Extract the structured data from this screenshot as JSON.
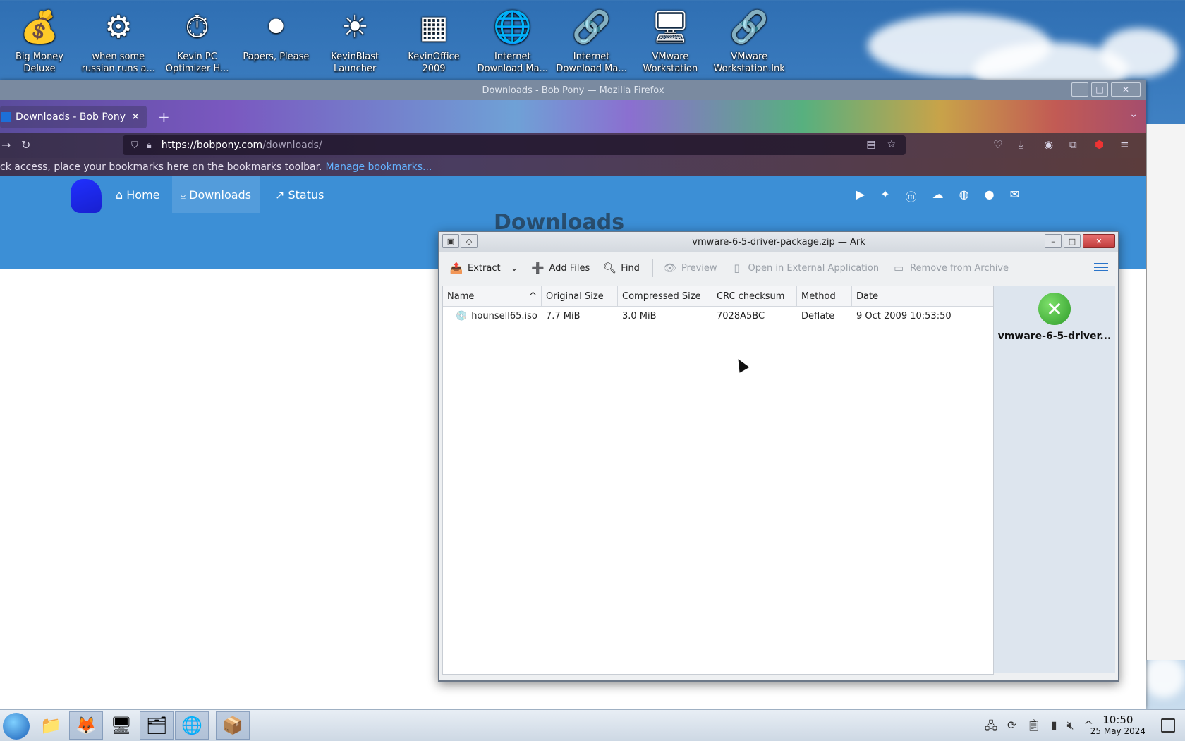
{
  "desktop": {
    "icons": [
      {
        "label": "Big Money\nDeluxe",
        "glyph": "💰",
        "icon": "money-bag-icon"
      },
      {
        "label": "when some\nrussian runs a...",
        "glyph": "⚙",
        "icon": "gear-icon"
      },
      {
        "label": "Kevin PC\nOptimizer H...",
        "glyph": "⏱",
        "icon": "speedometer-icon"
      },
      {
        "label": "Papers, Please",
        "glyph": "⚫",
        "icon": "papers-please-icon"
      },
      {
        "label": "KevinBlast\nLauncher",
        "glyph": "☀",
        "icon": "sunburst-icon"
      },
      {
        "label": "KevinOffice\n2009",
        "glyph": "▦",
        "icon": "office-icon"
      },
      {
        "label": "Internet\nDownload Ma...",
        "glyph": "🌐",
        "icon": "globe-download-icon"
      },
      {
        "label": "Internet\nDownload Ma...",
        "glyph": "🔗",
        "icon": "shortcut-link-icon"
      },
      {
        "label": "VMware\nWorkstation",
        "glyph": "🖥",
        "icon": "vmware-icon"
      },
      {
        "label": "VMware\nWorkstation.lnk",
        "glyph": "🔗",
        "icon": "shortcut-link-icon"
      }
    ]
  },
  "firefox": {
    "window_title": "Downloads - Bob Pony — Mozilla Firefox",
    "tab_title": "Downloads - Bob Pony",
    "tab_close": "✕",
    "new_tab": "+",
    "url_host": "https://bobpony.com",
    "url_path": "/downloads/",
    "bookmarks_text": "ck access, place your bookmarks here on the bookmarks toolbar.",
    "bookmarks_link": "Manage bookmarks...",
    "site_nav": [
      {
        "label": "Home",
        "glyph": "⌂"
      },
      {
        "label": "Downloads",
        "glyph": "⤓"
      },
      {
        "label": "Status",
        "glyph": "↗"
      }
    ],
    "page_heading": "Downloads"
  },
  "ark": {
    "window_title": "vmware-6-5-driver-package.zip — Ark",
    "toolbar": {
      "extract": "Extract",
      "add_files": "Add Files",
      "find": "Find",
      "preview": "Preview",
      "open_external": "Open in External Application",
      "remove": "Remove from Archive"
    },
    "columns": [
      "Name",
      "Original Size",
      "Compressed Size",
      "CRC checksum",
      "Method",
      "Date"
    ],
    "rows": [
      {
        "name": "hounsell65.iso",
        "original": "7.7 MiB",
        "compressed": "3.0 MiB",
        "crc": "7028A5BC",
        "method": "Deflate",
        "date": "9 Oct 2009 10:53:50"
      }
    ],
    "side_archive_name": "vmware-6-5-driver..."
  },
  "taskbar": {
    "time": "10:50",
    "date": "25 May 2024"
  },
  "colors": {
    "site_nav": "#3c8fd6",
    "ark_close": "#c03c3c",
    "link": "#64b3ff"
  }
}
